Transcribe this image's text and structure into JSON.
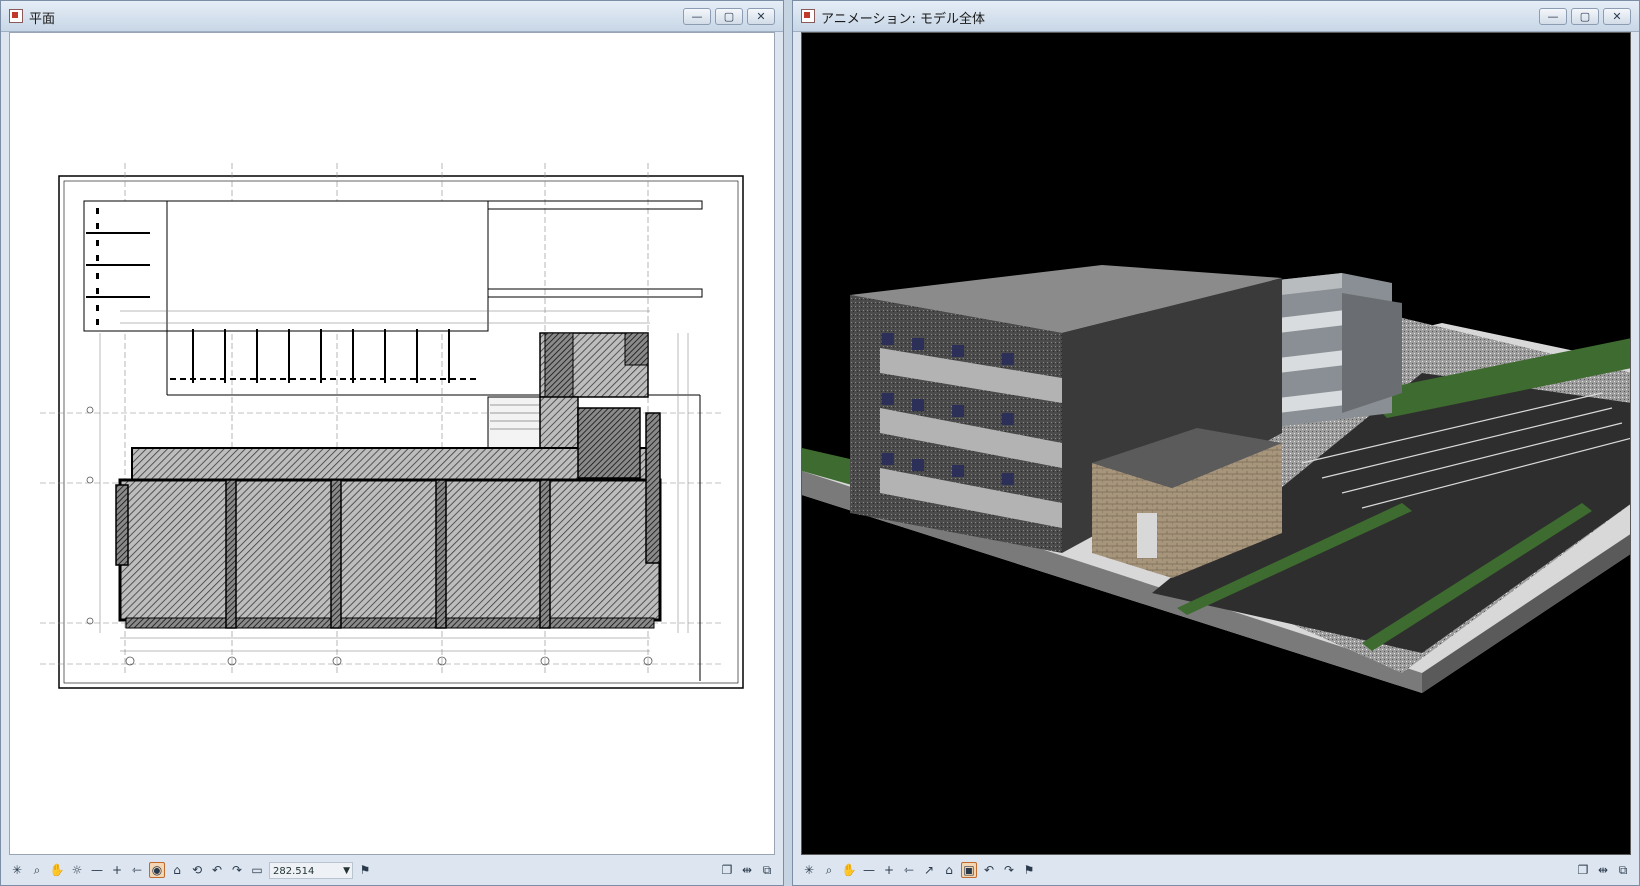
{
  "plan_window": {
    "title": "平面",
    "controls": {
      "minimize": "—",
      "maximize": "▢",
      "close": "✕"
    },
    "zoom_value": "282.514",
    "toolbar_icons": [
      "asterisk-icon",
      "zoom-icon",
      "pan-hand-icon",
      "sun-icon",
      "minus-icon",
      "plus-icon",
      "arrows-icon",
      "render-icon",
      "home-icon",
      "rotate-icon",
      "undo-icon",
      "redo-icon",
      "folder-icon"
    ],
    "right_icons": [
      "copy-window-icon",
      "split-icon",
      "paste-icon"
    ]
  },
  "anim_window": {
    "title": "アニメーション: モデル全体",
    "controls": {
      "minimize": "—",
      "maximize": "▢",
      "close": "✕"
    },
    "toolbar_icons": [
      "asterisk-icon",
      "zoom-icon",
      "pan-hand-icon",
      "minus-icon",
      "plus-icon",
      "arrows-icon",
      "walk-icon",
      "home-icon",
      "camera-icon",
      "undo-icon",
      "redo-icon",
      "flag-icon"
    ],
    "right_icons": [
      "copy-window-icon",
      "split-icon",
      "paste-icon"
    ]
  },
  "colors": {
    "plan_bg": "#ffffff",
    "anim_bg": "#000000",
    "accent": "#c06a2e"
  }
}
